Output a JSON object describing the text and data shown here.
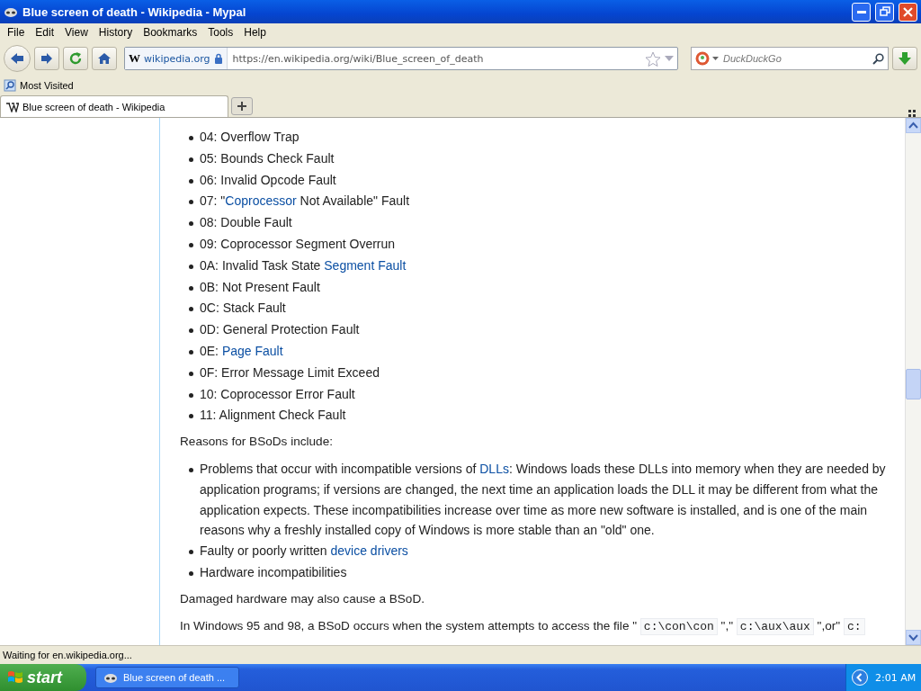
{
  "window": {
    "title": "Blue screen of death - Wikipedia - Mypal"
  },
  "menu": [
    "File",
    "Edit",
    "View",
    "History",
    "Bookmarks",
    "Tools",
    "Help"
  ],
  "address": {
    "logo": "W",
    "site": "wikipedia.org",
    "url": "https://en.wikipedia.org/wiki/Blue_screen_of_death"
  },
  "search": {
    "placeholder": "DuckDuckGo"
  },
  "bookmarks": [
    "Most Visited"
  ],
  "tabs": [
    {
      "label": "Blue screen of death - Wikipedia",
      "selected": true
    }
  ],
  "article": [
    {
      "kind": "list",
      "items": [
        [
          {
            "kind": "text",
            "text": "04: Overflow Trap"
          }
        ],
        [
          {
            "kind": "text",
            "text": "05: Bounds Check Fault"
          }
        ],
        [
          {
            "kind": "text",
            "text": "06: Invalid Opcode Fault"
          }
        ],
        [
          {
            "kind": "text",
            "text": "07: \""
          },
          {
            "kind": "link",
            "text": "Coprocessor"
          },
          {
            "kind": "text",
            "text": " Not Available\" Fault"
          }
        ],
        [
          {
            "kind": "text",
            "text": "08: Double Fault"
          }
        ],
        [
          {
            "kind": "text",
            "text": "09: Coprocessor Segment Overrun"
          }
        ],
        [
          {
            "kind": "text",
            "text": "0A: Invalid Task State "
          },
          {
            "kind": "link",
            "text": "Segment Fault"
          }
        ],
        [
          {
            "kind": "text",
            "text": "0B: Not Present Fault"
          }
        ],
        [
          {
            "kind": "text",
            "text": "0C: Stack Fault"
          }
        ],
        [
          {
            "kind": "text",
            "text": "0D: General Protection Fault"
          }
        ],
        [
          {
            "kind": "text",
            "text": "0E: "
          },
          {
            "kind": "link",
            "text": "Page Fault"
          }
        ],
        [
          {
            "kind": "text",
            "text": "0F: Error Message Limit Exceed"
          }
        ],
        [
          {
            "kind": "text",
            "text": "10: Coprocessor Error Fault"
          }
        ],
        [
          {
            "kind": "text",
            "text": "11: Alignment Check Fault"
          }
        ]
      ]
    },
    {
      "kind": "paragraph",
      "segments": [
        {
          "kind": "text",
          "text": "Reasons for BSoDs include:"
        }
      ]
    },
    {
      "kind": "list",
      "items": [
        [
          {
            "kind": "text",
            "text": "Problems that occur with incompatible versions of "
          },
          {
            "kind": "link",
            "text": "DLLs"
          },
          {
            "kind": "text",
            "text": ": Windows loads these DLLs into memory when they are needed by application programs; if versions are changed, the next time an application loads the DLL it may be different from what the application expects. These incompatibilities increase over time as more new software is installed, and is one of the main reasons why a freshly installed copy of Windows is more stable than an \"old\" one."
          }
        ],
        [
          {
            "kind": "text",
            "text": "Faulty or poorly written "
          },
          {
            "kind": "link",
            "text": "device drivers"
          }
        ],
        [
          {
            "kind": "text",
            "text": "Hardware incompatibilities"
          }
        ]
      ]
    },
    {
      "kind": "paragraph",
      "segments": [
        {
          "kind": "text",
          "text": "Damaged hardware may also cause a BSoD."
        }
      ]
    },
    {
      "kind": "paragraph",
      "segments": [
        {
          "kind": "text",
          "text": "In Windows 95 and 98, a BSoD occurs when the system attempts to access the file \" "
        },
        {
          "kind": "code",
          "text": "c:\\con\\con"
        },
        {
          "kind": "text",
          "text": " \",\" "
        },
        {
          "kind": "code",
          "text": "c:\\aux\\aux"
        },
        {
          "kind": "text",
          "text": " \",or\" "
        },
        {
          "kind": "code",
          "text": "c:"
        }
      ]
    }
  ],
  "status_bar": "Waiting for en.wikipedia.org...",
  "taskbar": {
    "start": "start",
    "tasks": [
      {
        "label": "Blue screen of death ...",
        "selected": false
      }
    ],
    "clock": "2:01 AM"
  }
}
